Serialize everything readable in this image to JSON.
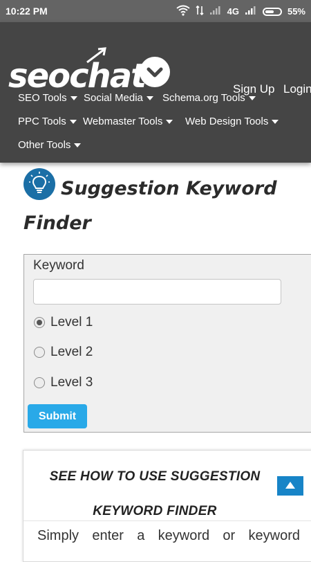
{
  "status_bar": {
    "time": "10:22 PM",
    "network": "4G",
    "battery": "55%"
  },
  "header": {
    "logo_text": "seochat",
    "sign_up": "Sign Up",
    "login": "Login",
    "nav": [
      {
        "label": "SEO Tools"
      },
      {
        "label": "Social Media"
      },
      {
        "label": "Schema.org Tools"
      },
      {
        "label": "PPC Tools"
      },
      {
        "label": "Webmaster Tools"
      },
      {
        "label": "Web Design Tools"
      },
      {
        "label": "Other Tools"
      }
    ]
  },
  "page": {
    "title": "Suggestion Keyword Finder",
    "title_icon": "lightbulb-icon"
  },
  "form": {
    "keyword_label": "Keyword",
    "keyword_value": "",
    "levels": [
      {
        "label": "Level 1",
        "checked": true
      },
      {
        "label": "Level 2",
        "checked": false
      },
      {
        "label": "Level 3",
        "checked": false
      }
    ],
    "submit_label": "Submit"
  },
  "info": {
    "heading": "SEE HOW TO USE SUGGESTION KEYWORD FINDER",
    "body": "Simply enter a keyword or keyword"
  },
  "colors": {
    "status_bar": "#646464",
    "header_bg": "#454545",
    "submit": "#29a9e8",
    "icon_blue": "#1b6fa6",
    "back_to_top": "#1784c7"
  }
}
